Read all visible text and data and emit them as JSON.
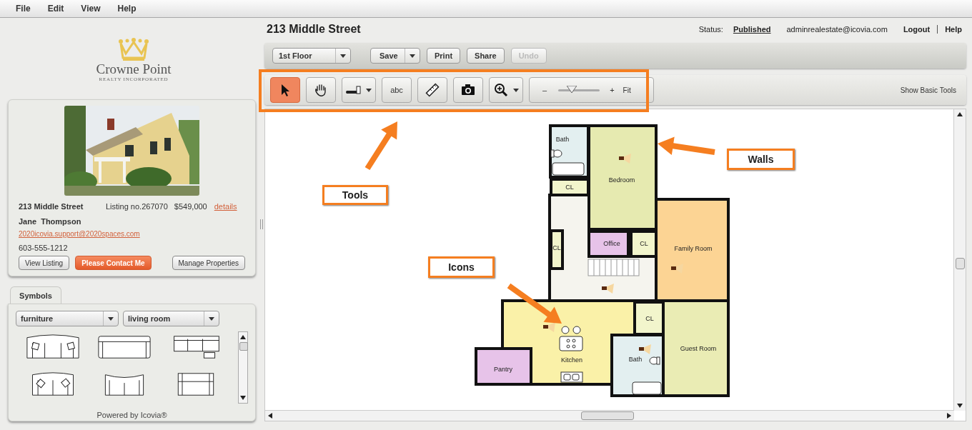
{
  "menu": [
    {
      "label": "File"
    },
    {
      "label": "Edit"
    },
    {
      "label": "View"
    },
    {
      "label": "Help"
    }
  ],
  "logo": {
    "name": "Crowne Point",
    "tagline": "REALTY INCORPORATED"
  },
  "listing": {
    "address": "213 Middle Street",
    "listing_no": "Listing no.267070",
    "price": "$549,000",
    "details_link": "details",
    "agent": "Jane  Thompson",
    "email": "2020icovia.support@2020spaces.com",
    "phone": "603-555-1212",
    "buttons": [
      {
        "label": "View Listing",
        "kind": "default"
      },
      {
        "label": "Please Contact Me",
        "kind": "primary"
      },
      {
        "label": "Manage Properties",
        "kind": "default"
      }
    ]
  },
  "symbols": {
    "tabs": [
      {
        "label": "Symbols",
        "selected": true
      }
    ],
    "category": "furniture",
    "room": "living room",
    "footer": "Powered by Icovia®"
  },
  "header": {
    "title": "213 Middle Street",
    "status_label": "Status:",
    "status": "Published",
    "user": "adminrealestate@icovia.com",
    "links": [
      "Logout",
      "Help"
    ]
  },
  "toolbar": {
    "floor": "1st Floor",
    "buttons": [
      {
        "label": "Save",
        "kind": "split",
        "disabled": false
      },
      {
        "label": "Print",
        "kind": "plain",
        "disabled": false
      },
      {
        "label": "Share",
        "kind": "plain",
        "disabled": false
      },
      {
        "label": "Undo",
        "kind": "plain",
        "disabled": true
      }
    ]
  },
  "tools": [
    {
      "kind": "select",
      "selected": true
    },
    {
      "kind": "pan",
      "selected": false
    },
    {
      "kind": "wall",
      "selected": false
    },
    {
      "kind": "text",
      "label": "abc",
      "selected": false
    },
    {
      "kind": "measure",
      "selected": false
    },
    {
      "kind": "camera",
      "selected": false
    },
    {
      "kind": "zoom",
      "selected": false
    }
  ],
  "zoom": {
    "minus": "–",
    "plus": "+",
    "fit": "Fit",
    "level": 0.25
  },
  "show_basic_tools": "Show Basic Tools",
  "plan": {
    "rooms": [
      {
        "name": "Bath",
        "color": "#e3eff0"
      },
      {
        "name": "Bedroom",
        "color": "#e6eab0"
      },
      {
        "name": "CL",
        "color": "#f2f5cc"
      },
      {
        "name": "CL",
        "color": "#f2f5cc"
      },
      {
        "name": "Office",
        "color": "#e7c3e9"
      },
      {
        "name": "CL",
        "color": "#f2f5cc"
      },
      {
        "name": "Family Room",
        "color": "#fcd494"
      },
      {
        "name": "Kitchen",
        "color": "#faf1a8"
      },
      {
        "name": "Pantry",
        "color": "#e7c3e9"
      },
      {
        "name": "CL",
        "color": "#f2f5cc"
      },
      {
        "name": "Bath",
        "color": "#e3eff0"
      },
      {
        "name": "Guest Room",
        "color": "#eaecb4"
      }
    ]
  },
  "annotations": [
    {
      "label": "Tools"
    },
    {
      "label": "Walls"
    },
    {
      "label": "Icons"
    }
  ]
}
